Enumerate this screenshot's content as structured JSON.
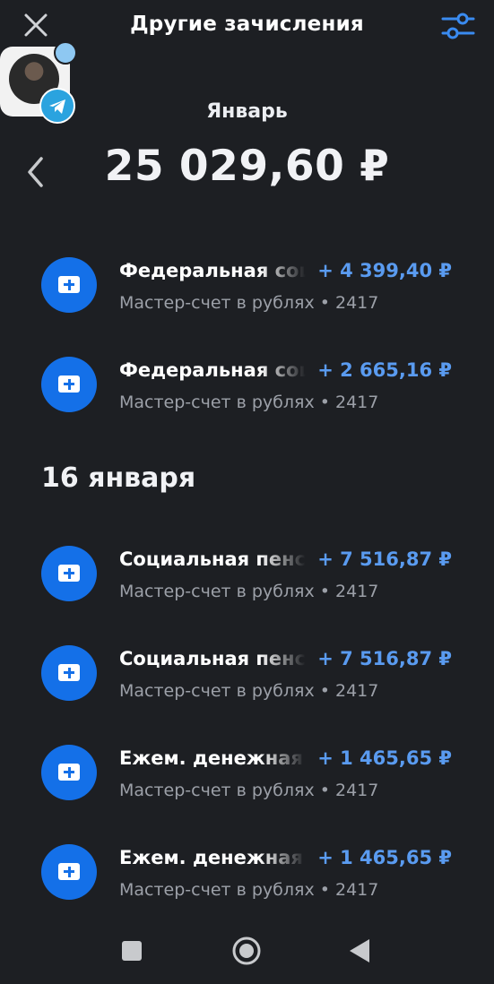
{
  "header": {
    "title": "Другие зачисления",
    "close_icon": "close-icon",
    "filter_icon": "filter-sliders-icon"
  },
  "summary": {
    "month": "Январь",
    "total": "25 029,60 ₽"
  },
  "groups": [
    {
      "date": "",
      "transactions": [
        {
          "name": "Федеральная социальная доплата",
          "amount": "+ 4 399,40 ₽",
          "account": "Мастер-счет в рублях • 2417"
        },
        {
          "name": "Федеральная социальная доплата",
          "amount": "+ 2 665,16 ₽",
          "account": "Мастер-счет в рублях • 2417"
        }
      ]
    },
    {
      "date": "16 января",
      "transactions": [
        {
          "name": "Социальная пенсия",
          "amount": "+ 7 516,87 ₽",
          "account": "Мастер-счет в рублях • 2417"
        },
        {
          "name": "Социальная пенсия",
          "amount": "+ 7 516,87 ₽",
          "account": "Мастер-счет в рублях • 2417"
        },
        {
          "name": "Ежем. денежная выплата",
          "amount": "+ 1 465,65 ₽",
          "account": "Мастер-счет в рублях • 2417"
        },
        {
          "name": "Ежем. денежная выплата",
          "amount": "+ 1 465,65 ₽",
          "account": "Мастер-счет в рублях • 2417"
        }
      ]
    }
  ],
  "colors": {
    "background": "#1d1f23",
    "accent": "#1470e8",
    "amount": "#5a9bf0"
  }
}
